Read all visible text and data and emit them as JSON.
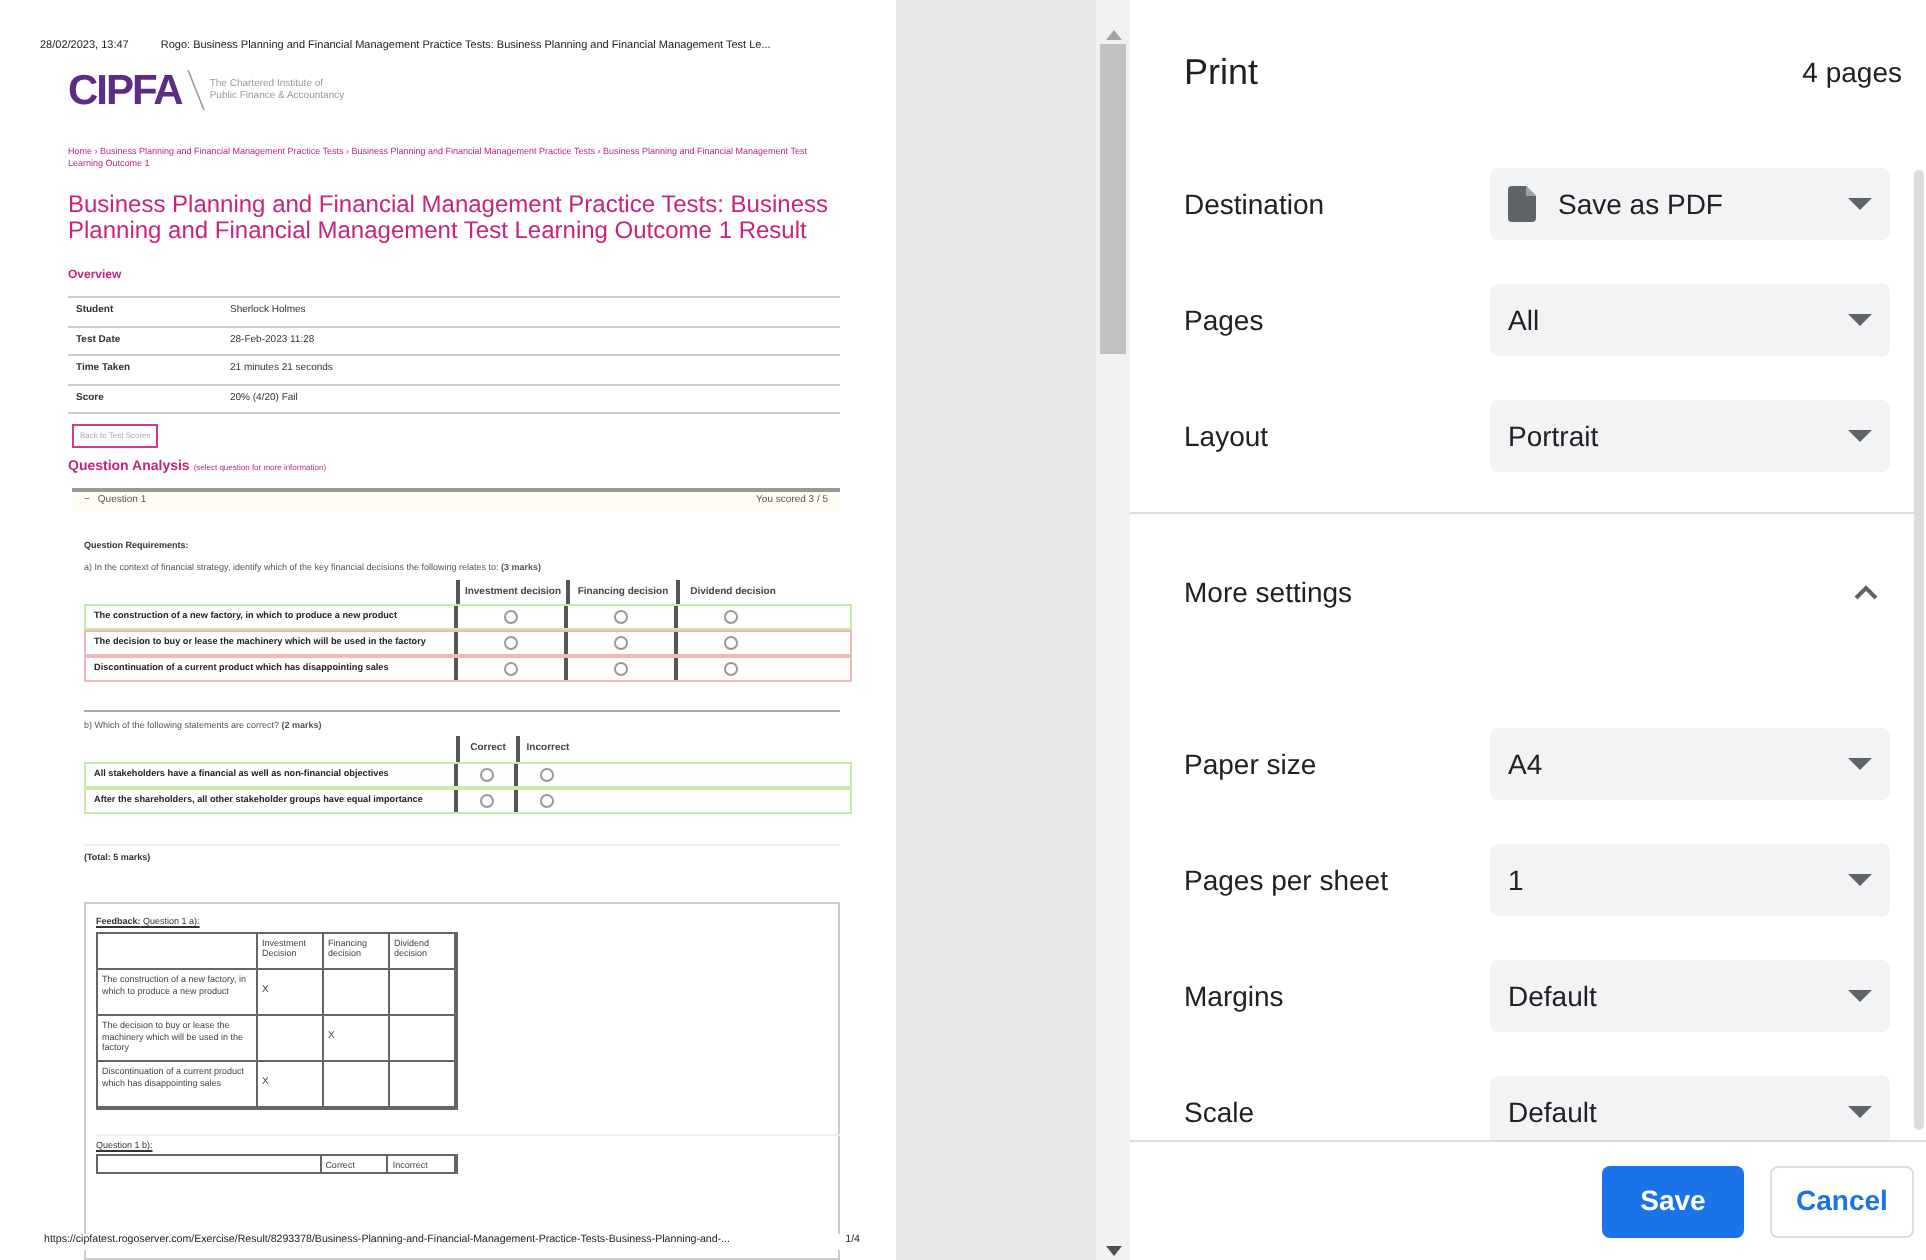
{
  "preview": {
    "header_date": "28/02/2023, 13:47",
    "header_title": "Rogo: Business Planning and Financial Management Practice Tests: Business Planning and Financial Management Test Le...",
    "logo_text": "CIPFA",
    "logo_subtitle": [
      "The Chartered Institute of",
      "Public Finance & Accountancy"
    ],
    "breadcrumb": "Home  ›  Business Planning and Financial Management Practice Tests  ›  Business Planning and Financial Management Practice Tests  ›  Business Planning and Financial Management Test Learning Outcome 1",
    "title": "Business Planning and Financial Management Practice Tests: Business Planning and Financial Management Test Learning Outcome 1 Result",
    "overview_heading": "Overview",
    "overview_rows": [
      {
        "label": "Student",
        "value": "Sherlock Holmes"
      },
      {
        "label": "Test Date",
        "value": "28-Feb-2023 11:28"
      },
      {
        "label": "Time Taken",
        "value": "21 minutes 21 seconds"
      },
      {
        "label": "Score",
        "value": "20% (4/20) Fail"
      }
    ],
    "back_button": "Back to Test Scores",
    "analysis_heading": "Question Analysis",
    "analysis_hint": "(select question for more information)",
    "question": {
      "toggle": "−",
      "label": "Question 1",
      "score": "You scored 3 / 5"
    },
    "requirements_label": "Question Requirements:",
    "part_a": "a) In the context of financial strategy, identify which of the key financial decisions the following relates to: **(3 marks)**",
    "table_a": {
      "columns": [
        "Investment decision",
        "Financing decision",
        "Dividend decision"
      ],
      "rows": [
        {
          "text": "The construction of a new factory, in which to produce a new product",
          "color": "#c9eaa8",
          "options": [
            {
              "selected": false
            },
            {
              "selected": false
            },
            {
              "selected": false
            }
          ]
        },
        {
          "text": "The decision to buy or lease the machinery which will be used in the factory",
          "color": "#f2b8b8",
          "options": [
            {
              "selected": false
            },
            {
              "selected": false
            },
            {
              "selected": false
            }
          ]
        },
        {
          "text": "Discontinuation of a current product which has disappointing sales",
          "color": "#f2b8b8",
          "options": [
            {
              "selected": false
            },
            {
              "selected": false
            },
            {
              "selected": false
            }
          ]
        }
      ]
    },
    "part_b": "b) Which of the following statements are correct? **(2 marks)**",
    "table_b": {
      "columns": [
        "Correct",
        "Incorrect"
      ],
      "rows": [
        {
          "text": "All stakeholders have a financial as well as non-financial objectives",
          "color": "#c9eaa8",
          "options": [
            {
              "selected": false
            },
            {
              "selected": false
            }
          ]
        },
        {
          "text": "After the shareholders, all other stakeholder groups have equal importance",
          "color": "#c9eaa8",
          "options": [
            {
              "selected": false
            },
            {
              "selected": false
            }
          ]
        }
      ]
    },
    "total": "(Total: 5 marks)",
    "feedback_label": "**Feedback:** Question 1 a):",
    "feedback_table": {
      "columns": [
        "Investment Decision",
        "Financing decision",
        "Dividend decision"
      ],
      "rows": [
        {
          "text": "The construction of a new factory, in which to produce a new product",
          "cells": [
            "X",
            null,
            null
          ]
        },
        {
          "text": "The decision to buy or lease the machinery which will be used in the factory",
          "cells": [
            null,
            "X",
            null
          ]
        },
        {
          "text": "Discontinuation of a current product which has disappointing sales",
          "cells": [
            "X",
            null,
            null
          ]
        }
      ]
    },
    "feedback_b_label": "Question 1 b):",
    "feedback_b_columns": [
      "Correct",
      "Incorrect"
    ],
    "footer_url": "https://cipfatest.rogoserver.com/Exercise/Result/8293378/Business-Planning-and-Financial-Management-Practice-Tests-Business-Planning-and-...",
    "page_number": "1/4"
  },
  "print": {
    "title": "Print",
    "page_count": "4 pages",
    "settings": [
      {
        "label": "Destination",
        "value": "Save as PDF",
        "kind": "pdf"
      },
      {
        "label": "Pages",
        "value": "All",
        "kind": "plain"
      },
      {
        "label": "Layout",
        "value": "Portrait",
        "kind": "plain"
      }
    ],
    "more_settings": {
      "label": "More settings",
      "expanded": true
    },
    "more": [
      {
        "label": "Paper size",
        "value": "A4"
      },
      {
        "label": "Pages per sheet",
        "value": "1"
      },
      {
        "label": "Margins",
        "value": "Default"
      },
      {
        "label": "Scale",
        "value": "Default"
      }
    ],
    "buttons": {
      "save": "Save",
      "cancel": "Cancel"
    }
  }
}
